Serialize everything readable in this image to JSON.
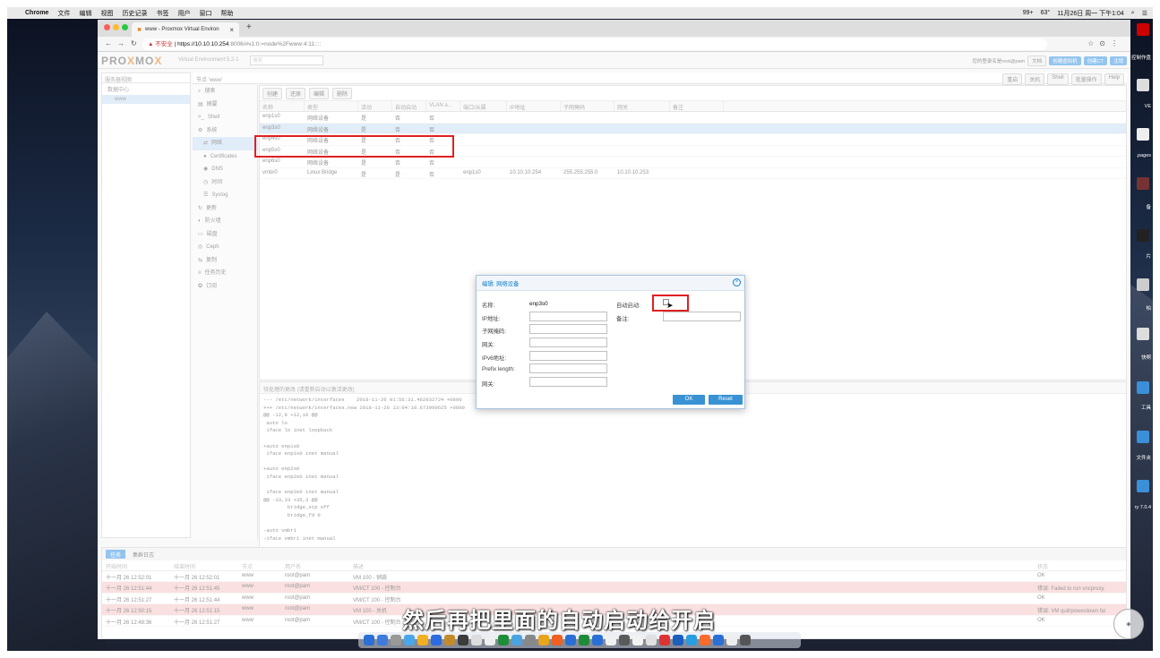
{
  "menubar": {
    "apple": "",
    "app": "Chrome",
    "items": [
      "文件",
      "编辑",
      "视图",
      "历史记录",
      "书签",
      "用户",
      "窗口",
      "帮助"
    ],
    "status": [
      "99+",
      "63°",
      "11月26日 周一 下午1:04"
    ]
  },
  "browser": {
    "tab_title": "www - Proxmox Virtual Environ",
    "url_warning": "▲ 不安全",
    "url_sep": " | ",
    "url_host": "https://10.10.10.254",
    "url_rest": ":8006/#v1:0:=node%2Fwww:4:11::::"
  },
  "pve": {
    "logo_a": "PRO",
    "logo_x": "X",
    "logo_b": "MO",
    "logo_x2": "X",
    "version": "Virtual Environment 5.2-1",
    "search": "搜索",
    "header_user": "您的登录名是root@pam",
    "header_buttons": [
      "文档",
      "创建虚拟机",
      "创建CT",
      "注销"
    ],
    "tree_view": "服务器视图",
    "tree_items": [
      "数据中心",
      "www"
    ],
    "crumb": "节点 'www'",
    "crumb_buttons": [
      "重启",
      "关机",
      "Shell",
      "批量操作",
      "Help"
    ],
    "nodemenu": [
      {
        "label": "搜索",
        "icon": "search-icon"
      },
      {
        "label": "摘要",
        "icon": "summary-icon"
      },
      {
        "label": "Shell",
        "icon": "shell-icon"
      },
      {
        "label": "系统",
        "icon": "gear-icon"
      },
      {
        "label": "网络",
        "icon": "network-icon",
        "sub": true,
        "selected": true
      },
      {
        "label": "Certificates",
        "icon": "certificate-icon",
        "sub": true
      },
      {
        "label": "DNS",
        "icon": "dns-icon",
        "sub": true
      },
      {
        "label": "时间",
        "icon": "clock-icon",
        "sub": true
      },
      {
        "label": "Syslog",
        "icon": "log-icon",
        "sub": true
      },
      {
        "label": "更新",
        "icon": "refresh-icon"
      },
      {
        "label": "防火墙",
        "icon": "shield-icon"
      },
      {
        "label": "磁盘",
        "icon": "disk-icon"
      },
      {
        "label": "Ceph",
        "icon": "ceph-icon"
      },
      {
        "label": "复制",
        "icon": "replication-icon"
      },
      {
        "label": "任务历史",
        "icon": "list-icon"
      },
      {
        "label": "订阅",
        "icon": "support-icon"
      }
    ],
    "net_toolbar": [
      "创建",
      "还原",
      "编辑",
      "删除"
    ],
    "net_columns": [
      "名称",
      "类型",
      "活动",
      "自动启动",
      "VLAN a...",
      "端口/从属",
      "IP地址",
      "子网掩码",
      "网关",
      "备注"
    ],
    "net_rows": [
      {
        "name": "enp1s0",
        "type": "网络设备",
        "active": "是",
        "auto": "否",
        "vlan": "否",
        "ports": "",
        "ip": "",
        "mask": "",
        "gw": ""
      },
      {
        "name": "enp3s0",
        "type": "网络设备",
        "active": "是",
        "auto": "否",
        "vlan": "否",
        "ports": "",
        "ip": "",
        "mask": "",
        "gw": "",
        "selected": true
      },
      {
        "name": "enp4s0",
        "type": "网络设备",
        "active": "是",
        "auto": "否",
        "vlan": "否",
        "ports": "",
        "ip": "",
        "mask": "",
        "gw": ""
      },
      {
        "name": "enp5s0",
        "type": "网络设备",
        "active": "是",
        "auto": "否",
        "vlan": "否",
        "ports": "",
        "ip": "",
        "mask": "",
        "gw": ""
      },
      {
        "name": "enp6s0",
        "type": "网络设备",
        "active": "是",
        "auto": "否",
        "vlan": "否",
        "ports": "",
        "ip": "",
        "mask": "",
        "gw": ""
      },
      {
        "name": "vmbr0",
        "type": "Linux Bridge",
        "active": "是",
        "auto": "是",
        "vlan": "否",
        "ports": "enp1s0",
        "ip": "10.10.10.254",
        "mask": "255.255.255.0",
        "gw": "10.10.10.253"
      }
    ],
    "pending_title": "待处理的更改 (请重新启动以激活更改)",
    "diff_text": "--- /etc/network/interfaces    2018-11-26 01:56:31.462932724 +0800\n+++ /etc/network/interfaces.new 2018-11-26 13:04:10.673999625 +0800\n@@ -12,8 +12,10 @@\n auto lo\n iface lo inet loopback\n\n+auto enp1s0\n iface enp1s0 inet manual\n\n+auto enp2s0\n iface enp2s0 inet manual\n\n iface enp3s0 inet manual\n@@ -33,33 +35,3 @@\n        bridge_stp off\n        bridge_fd 0\n\n-auto vmbr1\n-iface vmbr1 inet manual",
    "task_tabs": [
      "任务",
      "集群日志"
    ],
    "task_columns": [
      "开始时间",
      "结束时间",
      "节点",
      "用户名",
      "描述",
      "状态"
    ],
    "tasks": [
      {
        "start": "十一月 26 12:52:01",
        "end": "十一月 26 12:52:01",
        "node": "www",
        "user": "root@pam",
        "desc": "VM 100 - 销毁",
        "status": "OK"
      },
      {
        "start": "十一月 26 12:51:44",
        "end": "十一月 26 12:51:45",
        "node": "www",
        "user": "root@pam",
        "desc": "VM/CT 100 - 控制台",
        "status": "错误: Failed to run vncproxy.",
        "error": true
      },
      {
        "start": "十一月 26 12:51:27",
        "end": "十一月 26 12:51:44",
        "node": "www",
        "user": "root@pam",
        "desc": "VM/CT 100 - 控制台",
        "status": "OK"
      },
      {
        "start": "十一月 26 12:50:15",
        "end": "十一月 26 12:51:15",
        "node": "www",
        "user": "root@pam",
        "desc": "VM 100 - 关机",
        "status": "错误: VM quit/powerdown fai",
        "error": true
      },
      {
        "start": "十一月 26 12:48:36",
        "end": "十一月 26 12:51:27",
        "node": "www",
        "user": "root@pam",
        "desc": "VM/CT 100 - 控制台",
        "status": "OK"
      }
    ]
  },
  "dialog": {
    "title": "编辑: 网络设备",
    "name_label": "名称:",
    "name_value": "enp3s0",
    "ip_label": "IP地址:",
    "mask_label": "子网掩码:",
    "gw_label": "网关:",
    "ipv6_label": "IPv6地址:",
    "prefix_label": "Prefix length:",
    "gw6_label": "网关:",
    "autostart_label": "自动启动:",
    "autostart_checked": false,
    "comment_label": "备注:",
    "ok": "OK",
    "reset": "Reset"
  },
  "subtitle": "然后再把里面的自动启动给开启",
  "desktop_labels": [
    "控制作盘",
    "VE",
    ".pages",
    "备",
    "片",
    "柏",
    "快啊",
    "工具",
    "文件夹",
    "ry 7.0.4"
  ],
  "colors": {
    "accent": "#2b8ce0",
    "highlight_box": "#e02020",
    "selected_row": "#c5dcf2"
  }
}
